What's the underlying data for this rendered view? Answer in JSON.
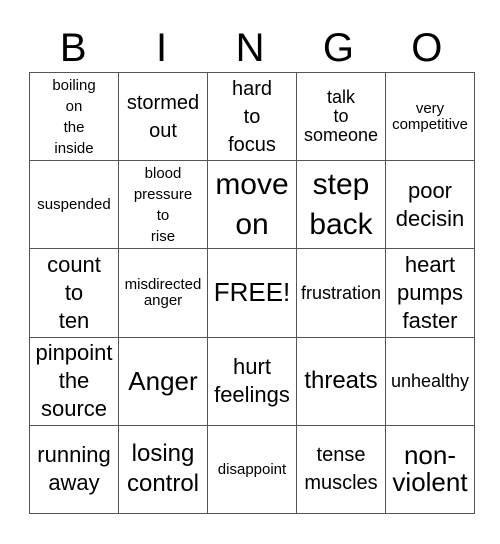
{
  "header": {
    "letters": [
      "B",
      "I",
      "N",
      "G",
      "O"
    ]
  },
  "grid": {
    "rows": [
      [
        {
          "text": "boiling\non\nthe\ninside",
          "size": "s14"
        },
        {
          "text": "stormed\nout",
          "size": "s20"
        },
        {
          "text": "hard\nto\nfocus",
          "size": "s20"
        },
        {
          "text": "talk\nto\nsomeone",
          "size": "s18"
        },
        {
          "text": "very\ncompetitive",
          "size": "s15"
        }
      ],
      [
        {
          "text": "suspended",
          "size": "s15"
        },
        {
          "text": "blood\npressure\nto\nrise",
          "size": "s14"
        },
        {
          "text": "move\non",
          "size": "s30"
        },
        {
          "text": "step\nback",
          "size": "s30"
        },
        {
          "text": "poor\ndecisin",
          "size": "s22"
        }
      ],
      [
        {
          "text": "count\nto\nten",
          "size": "s22"
        },
        {
          "text": "misdirected\nanger",
          "size": "s15"
        },
        {
          "text": "FREE!",
          "size": "s26"
        },
        {
          "text": "frustration",
          "size": "s18"
        },
        {
          "text": "heart\npumps\nfaster",
          "size": "s22"
        }
      ],
      [
        {
          "text": "pinpoint\nthe\nsource",
          "size": "s22"
        },
        {
          "text": "Anger",
          "size": "s26"
        },
        {
          "text": "hurt\nfeelings",
          "size": "s22"
        },
        {
          "text": "threats",
          "size": "s24"
        },
        {
          "text": "unhealthy",
          "size": "s18"
        }
      ],
      [
        {
          "text": "running\naway",
          "size": "s22"
        },
        {
          "text": "losing\ncontrol",
          "size": "s24"
        },
        {
          "text": "disappoint",
          "size": "s15"
        },
        {
          "text": "tense\nmuscles",
          "size": "s20"
        },
        {
          "text": "non-\nviolent",
          "size": "s26"
        }
      ]
    ]
  }
}
